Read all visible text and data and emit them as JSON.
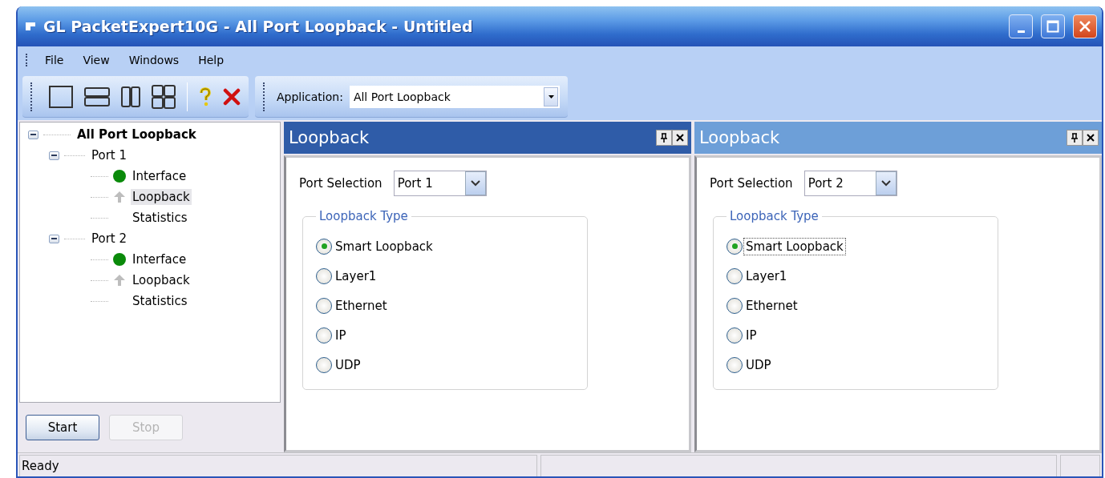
{
  "window": {
    "title": "GL PacketExpert10G - All Port Loopback - Untitled"
  },
  "menu": [
    {
      "label": "File"
    },
    {
      "label": "View"
    },
    {
      "label": "Windows"
    },
    {
      "label": "Help"
    }
  ],
  "application": {
    "label": "Application:",
    "value": "All Port Loopback"
  },
  "tree": {
    "label": "All Port Loopback",
    "selected": false,
    "expanded": true,
    "children": [
      {
        "label": "Port 1",
        "selected": false,
        "expanded": true,
        "children": [
          {
            "label": "Interface",
            "kind": "status",
            "selected": false
          },
          {
            "label": "Loopback",
            "kind": "loopback",
            "selected": true
          },
          {
            "label": "Statistics",
            "kind": "plain",
            "selected": false
          }
        ]
      },
      {
        "label": "Port 2",
        "selected": false,
        "expanded": true,
        "children": [
          {
            "label": "Interface",
            "kind": "status",
            "selected": false
          },
          {
            "label": "Loopback",
            "kind": "loopback",
            "selected": false
          },
          {
            "label": "Statistics",
            "kind": "plain",
            "selected": false
          }
        ]
      }
    ]
  },
  "buttons": [
    {
      "label": "Start",
      "disabled": false
    },
    {
      "label": "Stop",
      "disabled": true
    }
  ],
  "panels": [
    {
      "title": "Loopback",
      "active": true,
      "port_label": "Port Selection",
      "port_value": "Port 1",
      "group_title": "Loopback Type",
      "options": [
        {
          "label": "Smart Loopback",
          "selected": true,
          "focused": false
        },
        {
          "label": "Layer1",
          "selected": false,
          "focused": false
        },
        {
          "label": "Ethernet",
          "selected": false,
          "focused": false
        },
        {
          "label": "IP",
          "selected": false,
          "focused": false
        },
        {
          "label": "UDP",
          "selected": false,
          "focused": false
        }
      ]
    },
    {
      "title": "Loopback",
      "active": false,
      "port_label": "Port Selection",
      "port_value": "Port 2",
      "group_title": "Loopback Type",
      "options": [
        {
          "label": "Smart Loopback",
          "selected": true,
          "focused": true
        },
        {
          "label": "Layer1",
          "selected": false,
          "focused": false
        },
        {
          "label": "Ethernet",
          "selected": false,
          "focused": false
        },
        {
          "label": "IP",
          "selected": false,
          "focused": false
        },
        {
          "label": "UDP",
          "selected": false,
          "focused": false
        }
      ]
    }
  ],
  "status_bar": {
    "text": "Ready"
  }
}
